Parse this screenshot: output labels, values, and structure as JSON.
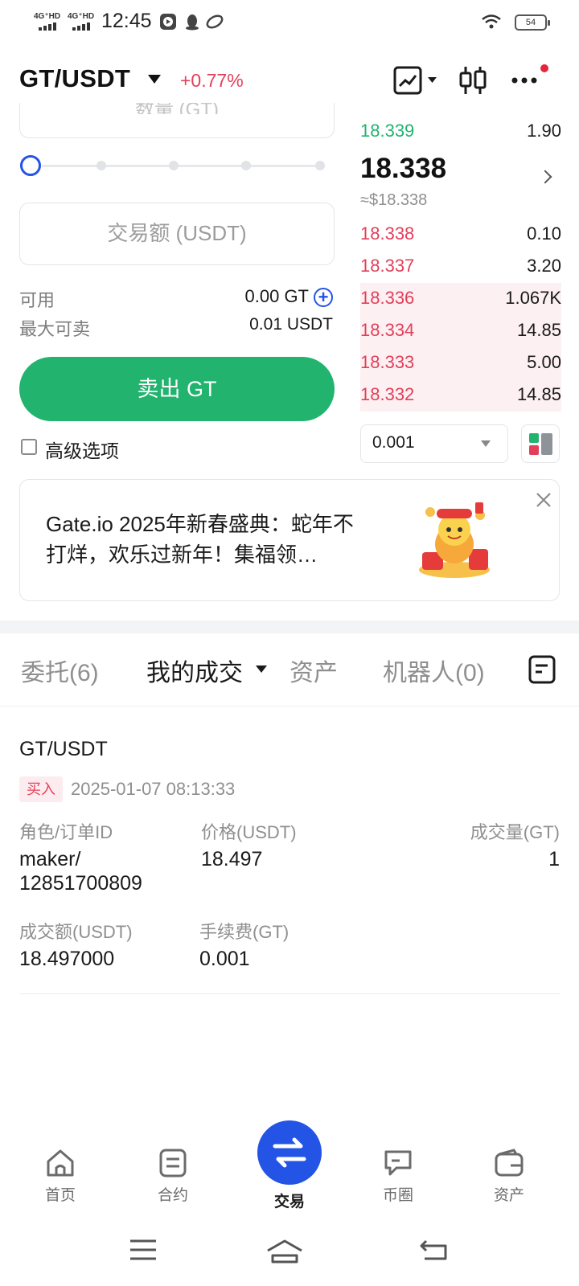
{
  "status_bar": {
    "net1": "4G⁺HD",
    "net2": "4G⁺HD",
    "time": "12:45",
    "battery": "54"
  },
  "header": {
    "pair": "GT/USDT",
    "change": "+0.77%",
    "icons": [
      "chart-icon",
      "candlestick-icon",
      "more-icon"
    ],
    "accent": "#2354e6",
    "down_color": "#e2405a",
    "up_color": "#22b36f"
  },
  "form": {
    "amount_placeholder_partial": "数量 (GT)",
    "slider_value_percent": 0,
    "trade_amount_placeholder": "交易额 (USDT)",
    "available_label": "可用",
    "available_value": "0.00 GT",
    "max_sell_label": "最大可卖",
    "max_sell_value": "0.01 USDT",
    "sell_button": "卖出 GT",
    "advanced_label": "高级选项",
    "advanced_checked": false
  },
  "orderbook": {
    "bid_top": {
      "price": "18.339",
      "qty": "1.90"
    },
    "last_price": "18.338",
    "last_price_usd": "≈$18.338",
    "asks": [
      {
        "price": "18.338",
        "qty": "0.10",
        "depth": 0
      },
      {
        "price": "18.337",
        "qty": "3.20",
        "depth": 0
      },
      {
        "price": "18.336",
        "qty": "1.067K",
        "depth": 1
      },
      {
        "price": "18.334",
        "qty": "14.85",
        "depth": 1
      },
      {
        "price": "18.333",
        "qty": "5.00",
        "depth": 1
      },
      {
        "price": "18.332",
        "qty": "14.85",
        "depth": 1
      }
    ],
    "precision": "0.001"
  },
  "banner": {
    "text": "Gate.io 2025年新春盛典：蛇年不打烊，欢乐过新年！集福领…"
  },
  "tabs": {
    "orders": "委托(6)",
    "my_trades": "我的成交",
    "assets": "资产",
    "bots": "机器人(0)"
  },
  "record": {
    "pair": "GT/USDT",
    "side": "买入",
    "time": "2025-01-07 08:13:33",
    "role_label": "角色/订单ID",
    "role_value_1": "maker/",
    "role_value_2": "12851700809",
    "price_label": "价格(USDT)",
    "price_value": "18.497",
    "qty_label": "成交量(GT)",
    "qty_value": "1",
    "total_label": "成交额(USDT)",
    "total_value": "18.497000",
    "fee_label": "手续费(GT)",
    "fee_value": "0.001"
  },
  "nav": {
    "home": "首页",
    "futures": "合约",
    "trade": "交易",
    "moments": "币圈",
    "assets": "资产"
  }
}
